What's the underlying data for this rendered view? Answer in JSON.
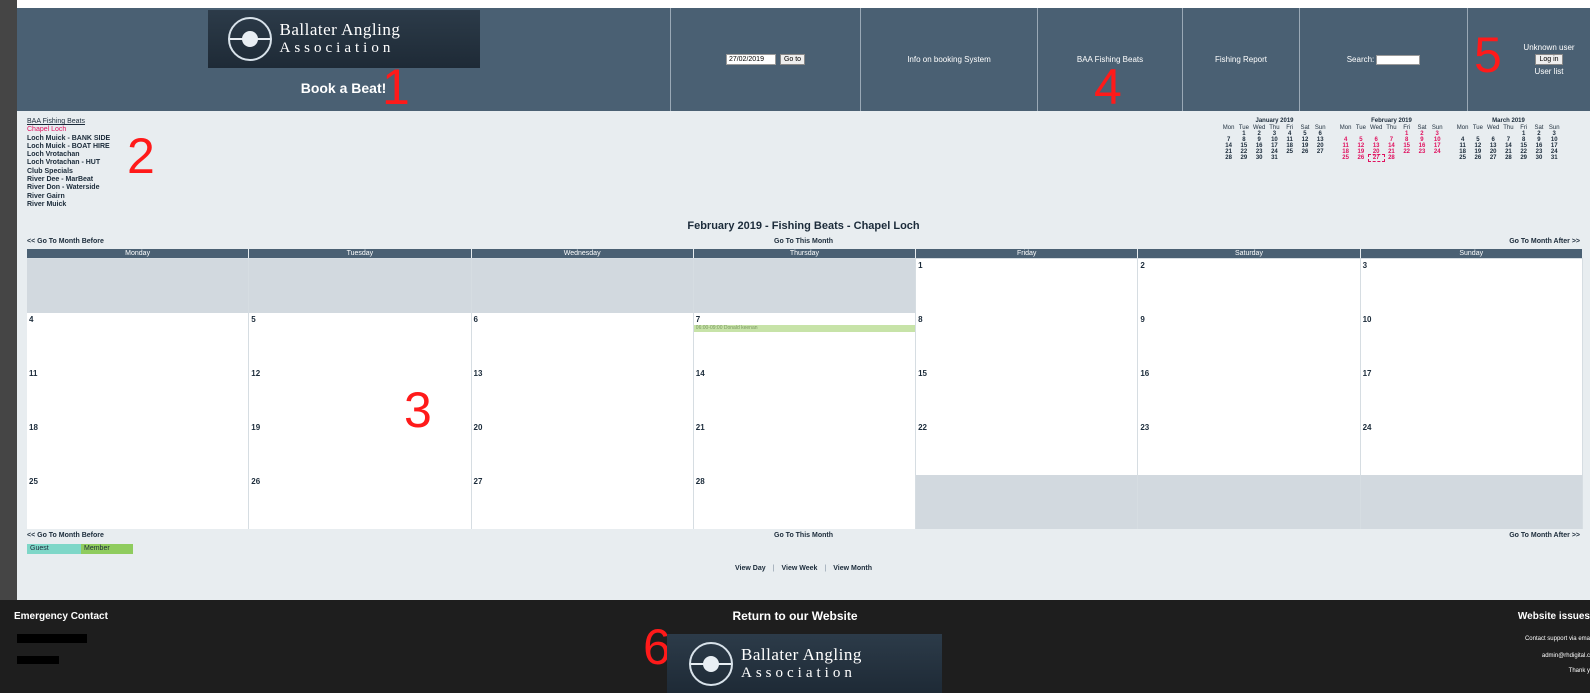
{
  "markers": [
    "1",
    "2",
    "3",
    "4",
    "5",
    "6"
  ],
  "logo": {
    "line1": "Ballater Angling",
    "line2": "Association"
  },
  "header": {
    "book_title": "Book a Beat!",
    "date_value": "27/02/2019",
    "goto_label": "Go to",
    "info_link": "Info on booking System",
    "beats_link": "BAA Fishing Beats",
    "report_link": "Fishing Report",
    "search_label": "Search:",
    "user_status": "Unknown user",
    "login_label": "Log in",
    "userlist_link": "User list"
  },
  "sidebar": {
    "heading": "BAA Fishing Beats",
    "items": [
      "Chapel Loch",
      "Loch Muick - BANK SIDE",
      "Loch Muick - BOAT HIRE",
      "Loch Vrotachan",
      "Loch Vrotachan - HUT",
      "Club Specials",
      "River Dee - MarBeat",
      "River Don - Waterside",
      "River Gairn",
      "River Muick"
    ],
    "active_index": 0
  },
  "mini_calendars": {
    "weekdays": [
      "Mon",
      "Tue",
      "Wed",
      "Thu",
      "Fri",
      "Sat",
      "Sun"
    ],
    "months": [
      {
        "title": "January 2019",
        "rows": [
          [
            "",
            "1",
            "2",
            "3",
            "4",
            "5",
            "6"
          ],
          [
            "7",
            "8",
            "9",
            "10",
            "11",
            "12",
            "13"
          ],
          [
            "14",
            "15",
            "16",
            "17",
            "18",
            "19",
            "20"
          ],
          [
            "21",
            "22",
            "23",
            "24",
            "25",
            "26",
            "27"
          ],
          [
            "28",
            "29",
            "30",
            "31",
            "",
            "",
            ""
          ]
        ]
      },
      {
        "title": "February 2019",
        "highlight": true,
        "today": "27",
        "rows": [
          [
            "",
            "",
            "",
            "",
            "1",
            "2",
            "3"
          ],
          [
            "4",
            "5",
            "6",
            "7",
            "8",
            "9",
            "10"
          ],
          [
            "11",
            "12",
            "13",
            "14",
            "15",
            "16",
            "17"
          ],
          [
            "18",
            "19",
            "20",
            "21",
            "22",
            "23",
            "24"
          ],
          [
            "25",
            "26",
            "27",
            "28",
            "",
            "",
            ""
          ]
        ]
      },
      {
        "title": "March 2019",
        "rows": [
          [
            "",
            "",
            "",
            "",
            "1",
            "2",
            "3"
          ],
          [
            "4",
            "5",
            "6",
            "7",
            "8",
            "9",
            "10"
          ],
          [
            "11",
            "12",
            "13",
            "14",
            "15",
            "16",
            "17"
          ],
          [
            "18",
            "19",
            "20",
            "21",
            "22",
            "23",
            "24"
          ],
          [
            "25",
            "26",
            "27",
            "28",
            "29",
            "30",
            "31"
          ]
        ]
      }
    ]
  },
  "calendar": {
    "title": "February 2019 - Fishing Beats - Chapel Loch",
    "prev_label": "<< Go To Month Before",
    "this_label": "Go To This Month",
    "next_label": "Go To Month After >>",
    "weekdays": [
      "Monday",
      "Tuesday",
      "Wednesday",
      "Thursday",
      "Friday",
      "Saturday",
      "Sunday"
    ],
    "weeks": [
      [
        "",
        "",
        "",
        "",
        "1",
        "2",
        "3"
      ],
      [
        "4",
        "5",
        "6",
        "7",
        "8",
        "9",
        "10"
      ],
      [
        "11",
        "12",
        "13",
        "14",
        "15",
        "16",
        "17"
      ],
      [
        "18",
        "19",
        "20",
        "21",
        "22",
        "23",
        "24"
      ],
      [
        "25",
        "26",
        "27",
        "28",
        "",
        "",
        ""
      ]
    ],
    "booking": {
      "day": "7",
      "text": "06:00-09:00 Donald keenan"
    }
  },
  "legend": {
    "guest": "Guest",
    "member": "Member"
  },
  "views": {
    "day": "View Day",
    "week": "View Week",
    "month": "View Month",
    "separator": "|"
  },
  "footer": {
    "emergency_title": "Emergency Contact",
    "return_title": "Return to our Website",
    "issues_title": "Website issues",
    "issues_lines": [
      "Contact support via ema",
      "admin@rhdigital.c",
      "Thank y"
    ]
  },
  "colors": {
    "header_bg": "#4a6073",
    "active_beat": "#e0115f",
    "guest": "#7ed7c8",
    "member": "#8fcc5e",
    "booking": "#c7e3a8"
  }
}
